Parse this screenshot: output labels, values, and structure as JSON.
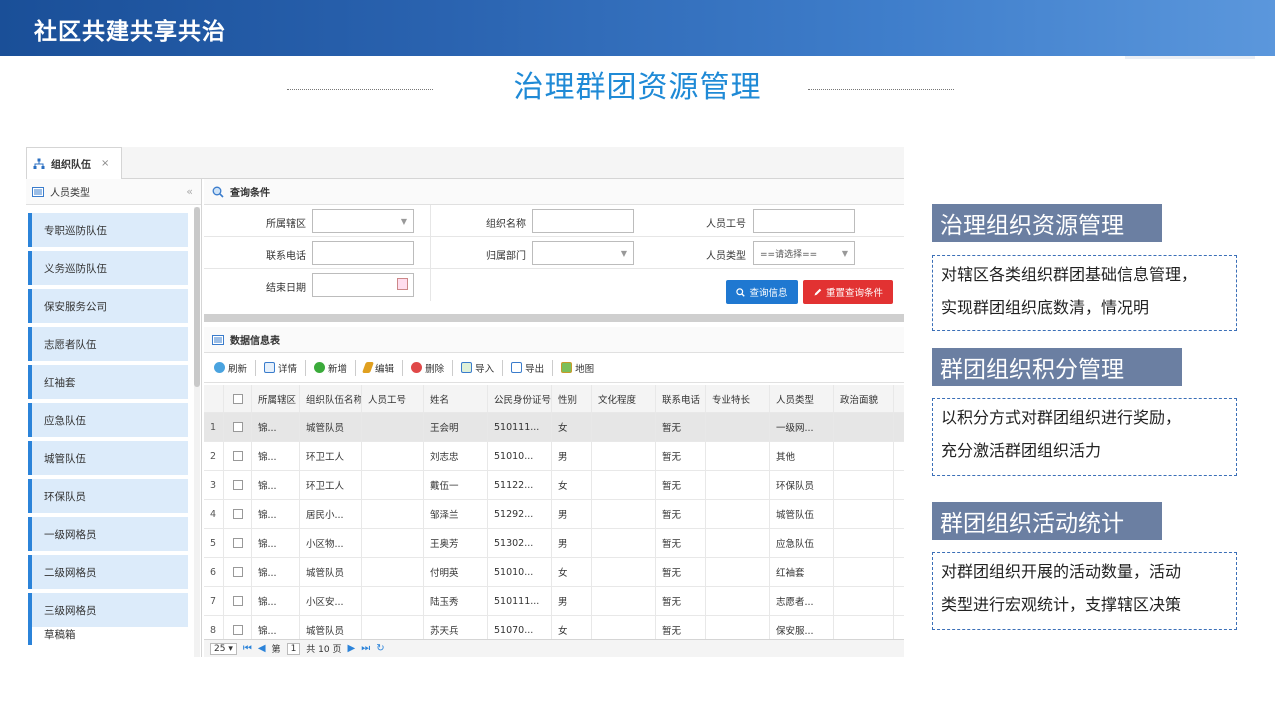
{
  "banner": {
    "title": "社区共建共享共治"
  },
  "main_title": "治理群团资源管理",
  "app": {
    "tab": {
      "label": "组织队伍",
      "close": "×"
    },
    "sidebar": {
      "header": "人员类型",
      "collapse": "«",
      "items": [
        "专职巡防队伍",
        "义务巡防队伍",
        "保安服务公司",
        "志愿者队伍",
        "红袖套",
        "应急队伍",
        "城管队伍",
        "环保队员",
        "一级网格员",
        "二级网格员",
        "三级网格员",
        "草稿箱"
      ]
    },
    "query": {
      "header": "查询条件",
      "labels": {
        "district": "所属辖区",
        "org_name": "组织名称",
        "staff_no": "人员工号",
        "phone": "联系电话",
        "dept": "归属部门",
        "staff_type": "人员类型",
        "end_date": "结束日期"
      },
      "staff_type_value": "==请选择==",
      "search_button": "查询信息",
      "reset_button": "重置查询条件"
    },
    "datatable": {
      "header": "数据信息表",
      "toolbar": [
        "刷新",
        "详情",
        "新增",
        "编辑",
        "删除",
        "导入",
        "导出",
        "地图"
      ],
      "columns": [
        "所属辖区",
        "组织队伍名称",
        "人员工号",
        "姓名",
        "公民身份证号",
        "性别",
        "文化程度",
        "联系电话",
        "专业特长",
        "人员类型",
        "政治面貌"
      ],
      "rows": [
        {
          "no": "1",
          "district": "锦...",
          "org": "城管队员",
          "staff": "",
          "name": "王会明",
          "id": "510111...",
          "sex": "女",
          "edu": "",
          "phone": "暂无",
          "skill": "",
          "type": "一级网...",
          "political": ""
        },
        {
          "no": "2",
          "district": "锦...",
          "org": "环卫工人",
          "staff": "",
          "name": "刘志忠",
          "id": "51010...",
          "sex": "男",
          "edu": "",
          "phone": "暂无",
          "skill": "",
          "type": "其他",
          "political": ""
        },
        {
          "no": "3",
          "district": "锦...",
          "org": "环卫工人",
          "staff": "",
          "name": "戴伍一",
          "id": "51122...",
          "sex": "女",
          "edu": "",
          "phone": "暂无",
          "skill": "",
          "type": "环保队员",
          "political": ""
        },
        {
          "no": "4",
          "district": "锦...",
          "org": "居民小...",
          "staff": "",
          "name": "邹泽兰",
          "id": "51292...",
          "sex": "男",
          "edu": "",
          "phone": "暂无",
          "skill": "",
          "type": "城管队伍",
          "political": ""
        },
        {
          "no": "5",
          "district": "锦...",
          "org": "小区物...",
          "staff": "",
          "name": "王奥芳",
          "id": "51302...",
          "sex": "男",
          "edu": "",
          "phone": "暂无",
          "skill": "",
          "type": "应急队伍",
          "political": ""
        },
        {
          "no": "6",
          "district": "锦...",
          "org": "城管队员",
          "staff": "",
          "name": "付明英",
          "id": "51010...",
          "sex": "女",
          "edu": "",
          "phone": "暂无",
          "skill": "",
          "type": "红袖套",
          "political": ""
        },
        {
          "no": "7",
          "district": "锦...",
          "org": "小区安...",
          "staff": "",
          "name": "陆玉秀",
          "id": "510111...",
          "sex": "男",
          "edu": "",
          "phone": "暂无",
          "skill": "",
          "type": "志愿者...",
          "political": ""
        },
        {
          "no": "8",
          "district": "锦...",
          "org": "城管队员",
          "staff": "",
          "name": "苏天兵",
          "id": "51070...",
          "sex": "女",
          "edu": "",
          "phone": "暂无",
          "skill": "",
          "type": "保安服...",
          "political": ""
        }
      ],
      "pager": {
        "page_size": "25 ▾",
        "page_prefix": "第",
        "page": "1",
        "page_total": "共 10 页"
      }
    }
  },
  "right_panel": [
    {
      "title": "治理组织资源管理",
      "lines": [
        "对辖区各类组织群团基础信息管理，",
        "实现群团组织底数清，情况明"
      ]
    },
    {
      "title": "群团组织积分管理",
      "lines": [
        "以积分方式对群团组织进行奖励，",
        "充分激活群团组织活力"
      ]
    },
    {
      "title": "群团组织活动统计",
      "lines": [
        "对群团组织开展的活动数量，活动",
        "类型进行宏观统计，支撑辖区决策"
      ]
    }
  ],
  "colors": {
    "banner": "#2a63b0",
    "accent": "#1f8ad6",
    "panel_title": "#6b7fa2",
    "search_btn": "#1f78d1",
    "reset_btn": "#e23232",
    "sidebar_item": "#dcebfa"
  }
}
